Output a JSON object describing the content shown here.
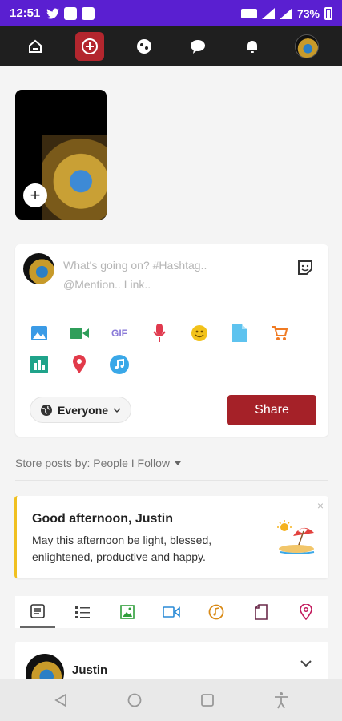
{
  "status_bar": {
    "time": "12:51",
    "battery": "73%",
    "background": "#5a1fd1"
  },
  "top_nav": {
    "items": [
      "home-icon",
      "create-post-icon",
      "explore-icon",
      "chat-icon",
      "bell-icon",
      "profile-avatar"
    ],
    "accent": "#b3262e"
  },
  "story": {
    "add_icon": "plus-icon"
  },
  "composer": {
    "placeholder_line1": "What's going on? #Hashtag..",
    "placeholder_line2": "@Mention.. Link..",
    "tools_row1": [
      "image-icon",
      "video-icon",
      "gif-icon",
      "microphone-icon",
      "emoji-icon",
      "file-icon",
      "cart-icon"
    ],
    "tools_row2": [
      "poll-icon",
      "location-icon",
      "music-icon"
    ],
    "gif_label": "GIF",
    "audience": "Everyone",
    "share_label": "Share",
    "share_color": "#a52128"
  },
  "filter": {
    "label": "Store posts by: People I Follow"
  },
  "greeting": {
    "title": "Good afternoon, Justin",
    "message": "May this afternoon be light, blessed, enlightened, productive and happy.",
    "close": "×",
    "accent": "#f0c020"
  },
  "post_type_tabs": [
    "all-posts-icon",
    "text-list-icon",
    "photos-icon",
    "videos-icon",
    "music-icon",
    "files-icon",
    "places-icon"
  ],
  "post": {
    "author": "Justin"
  }
}
